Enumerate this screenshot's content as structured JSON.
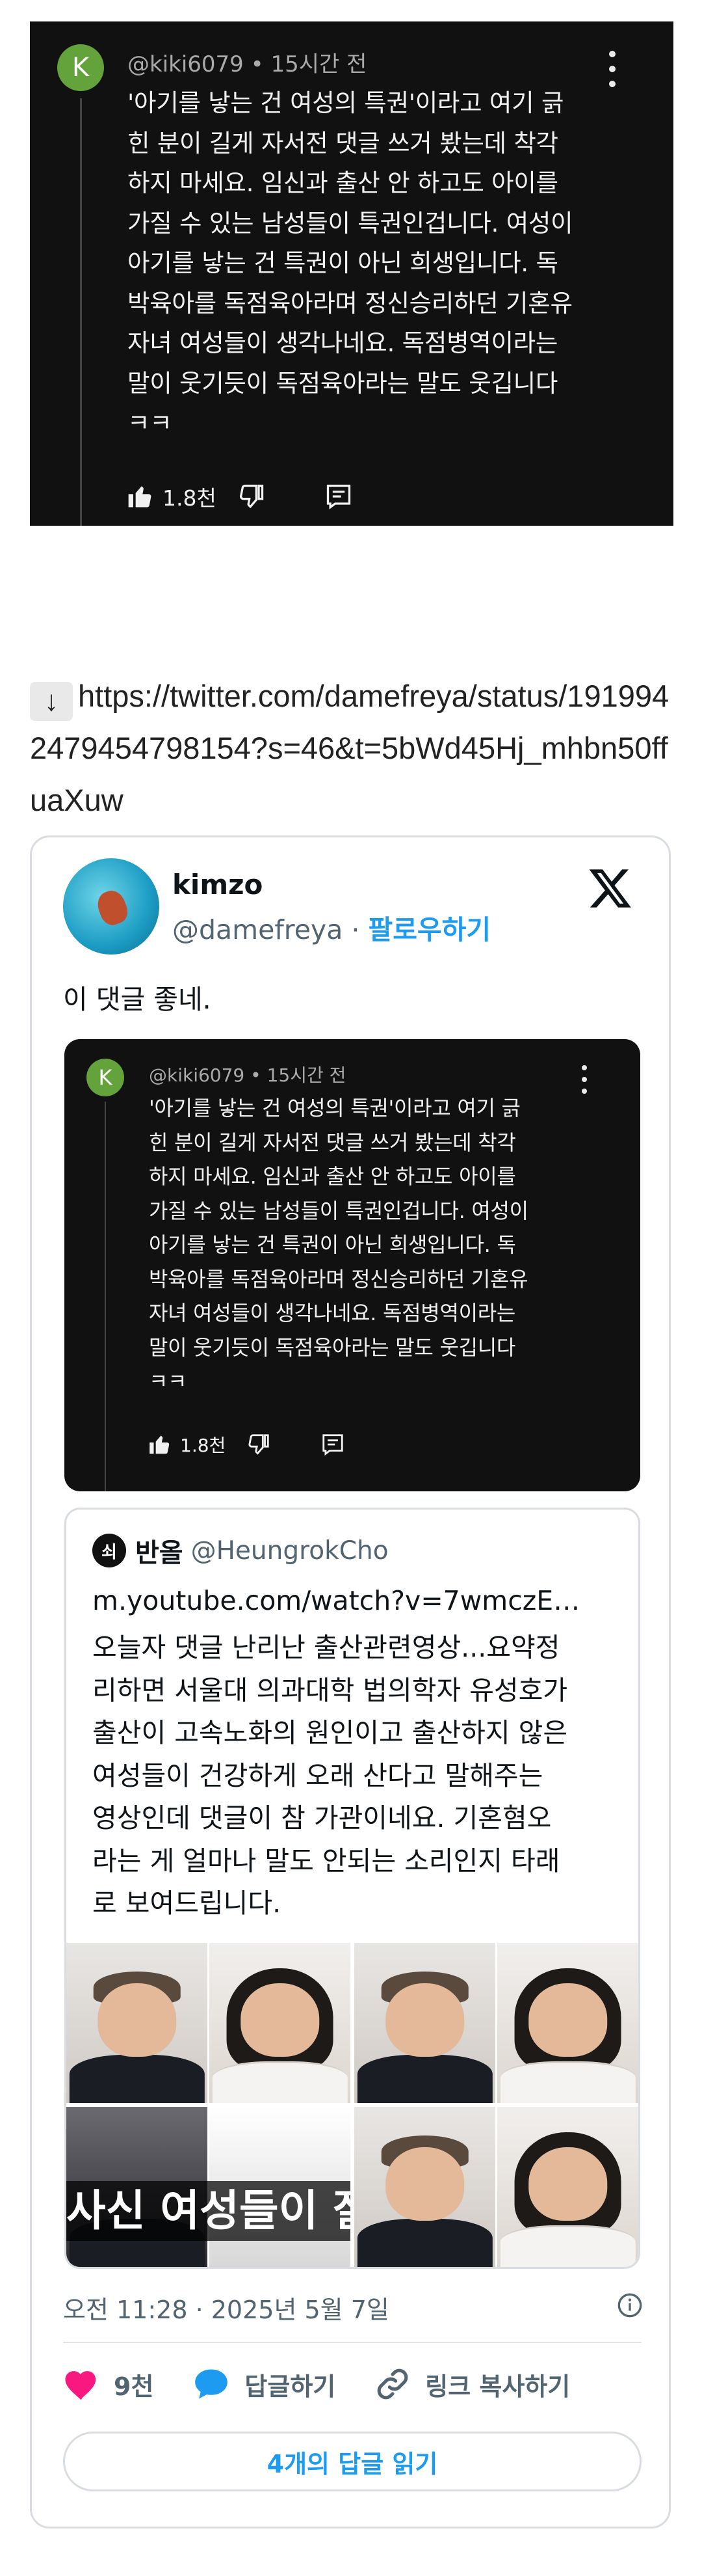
{
  "top_comment": {
    "avatar_letter": "K",
    "author": "@kiki6079",
    "time": "15시간 전",
    "lines": [
      "'아기를 낳는 건 여성의 특권'이라고 여기 긁",
      "힌 분이 길게 자서전 댓글 쓰거 봤는데 착각",
      "하지 마세요. 임신과 출산 안 하고도 아이를",
      "가질 수 있는 남성들이 특권인겁니다. 여성이",
      "아기를 낳는 건 특권이 아닌 희생입니다. 독",
      "박육아를 독점육아라며 정신승리하던 기혼유",
      "자녀 여성들이 생각나네요. 독점병역이라는",
      "말이 웃기듯이 독점육아라는 말도 웃깁니다",
      "ㅋㅋ"
    ],
    "like_count": "1.8천",
    "icons": [
      "thumbs-up-icon",
      "thumbs-down-icon",
      "reply-icon",
      "more-vert-icon"
    ]
  },
  "link": {
    "arrow": "↓",
    "url": "https://twitter.com/damefreya/status/1919942479454798154?s=46&t=5bWd45Hj_mhbn50ffuaXuw"
  },
  "tweet": {
    "name": "kimzo",
    "handle": "@damefreya",
    "separator": "·",
    "follow_label": "팔로우하기",
    "text": "이 댓글 좋네.",
    "embedded_comment": {
      "avatar_letter": "K",
      "author": "@kiki6079",
      "time": "15시간 전",
      "lines": [
        "'아기를 낳는 건 여성의 특권'이라고 여기 긁",
        "힌 분이 길게 자서전 댓글 쓰거 봤는데 착각",
        "하지 마세요. 임신과 출산 안 하고도 아이를",
        "가질 수 있는 남성들이 특권인겁니다. 여성이",
        "아기를 낳는 건 특권이 아닌 희생입니다. 독",
        "박육아를 독점육아라며 정신승리하던 기혼유",
        "자녀 여성들이 생각나네요. 독점병역이라는",
        "말이 웃기듯이 독점육아라는 말도 웃깁니다",
        "ㅋㅋ"
      ],
      "like_count": "1.8천"
    },
    "quote": {
      "avatar_text": "쇠",
      "name": "반올",
      "handle": "@HeungrokCho",
      "url": "m.youtube.com/watch?v=7wmczE…",
      "lines": [
        "오늘자 댓글 난리난 출산관련영상...요약정",
        "리하면 서울대 의과대학 법의학자 유성호가",
        "출산이 고속노화의 원인이고 출산하지 않은",
        "여성들이 건강하게 오래 산다고 말해주는",
        "영상인데 댓글이 참 가관이네요. 기혼혐오",
        "라는 게 얼마나 말도 안되는 소리인지 타래",
        "로 보여드립니다."
      ],
      "video_subtitle": "사신 여성들이 잘"
    },
    "timestamp": "오전 11:28 · 2025년 5월 7일",
    "likes": "9천",
    "reply_label": "답글하기",
    "copy_link_label": "링크 복사하기",
    "read_replies_label": "4개의 답글 읽기",
    "colors": {
      "accent": "#1d9bf0",
      "heart": "#f91880",
      "dark_bg": "#111111",
      "avatar_green": "#64a33b"
    }
  }
}
